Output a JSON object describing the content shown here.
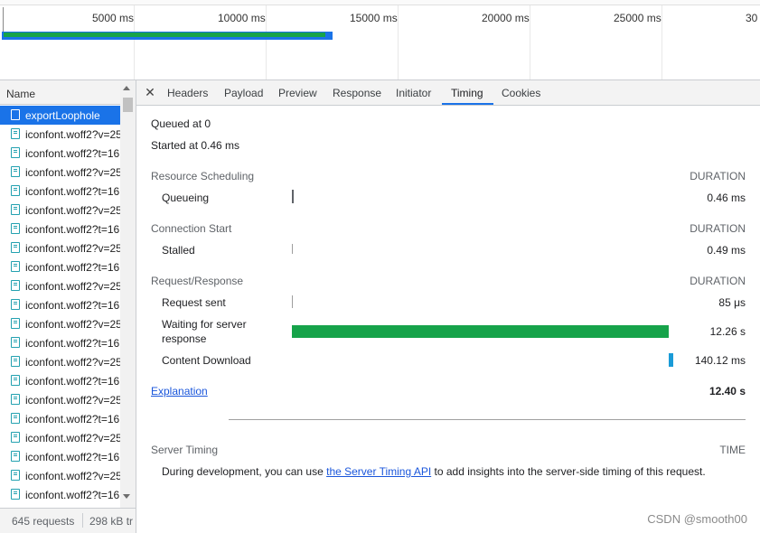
{
  "overview": {
    "ticks": [
      "5000 ms",
      "10000 ms",
      "15000 ms",
      "20000 ms",
      "25000 ms",
      "30"
    ]
  },
  "request_list": {
    "column_header": "Name",
    "rows": [
      "exportLoophole",
      "iconfont.woff2?v=25",
      "iconfont.woff2?t=16",
      "iconfont.woff2?v=25",
      "iconfont.woff2?t=16",
      "iconfont.woff2?v=25",
      "iconfont.woff2?t=16",
      "iconfont.woff2?v=25",
      "iconfont.woff2?t=16",
      "iconfont.woff2?v=25",
      "iconfont.woff2?t=16",
      "iconfont.woff2?v=25",
      "iconfont.woff2?t=16",
      "iconfont.woff2?v=25",
      "iconfont.woff2?t=16",
      "iconfont.woff2?v=25",
      "iconfont.woff2?t=16",
      "iconfont.woff2?v=25",
      "iconfont.woff2?t=16",
      "iconfont.woff2?v=25",
      "iconfont.woff2?t=16"
    ],
    "footer": {
      "requests": "645 requests",
      "transferred": "298 kB tr"
    }
  },
  "tabs": [
    "Headers",
    "Payload",
    "Preview",
    "Response",
    "Initiator",
    "Timing",
    "Cookies"
  ],
  "timing": {
    "queued_at": "Queued at 0",
    "started_at": "Started at 0.46 ms",
    "duration_label": "DURATION",
    "resource_scheduling": {
      "title": "Resource Scheduling",
      "queueing_label": "Queueing",
      "queueing_value": "0.46 ms"
    },
    "connection_start": {
      "title": "Connection Start",
      "stalled_label": "Stalled",
      "stalled_value": "0.49 ms"
    },
    "request_response": {
      "title": "Request/Response",
      "request_sent_label": "Request sent",
      "request_sent_value": "85 μs",
      "waiting_label_1": "Waiting for server",
      "waiting_label_2": "response",
      "waiting_value": "12.26 s",
      "download_label": "Content Download",
      "download_value": "140.12 ms"
    },
    "explanation": "Explanation",
    "total": "12.40 s"
  },
  "server_timing": {
    "title": "Server Timing",
    "time_label": "TIME",
    "text_before": "During development, you can use ",
    "link": "the Server Timing API",
    "text_after": " to add insights into the server-side timing of this request."
  },
  "watermark": "CSDN @smooth00",
  "colors": {
    "accent": "#1a73e8",
    "waiting_bar": "#16a34a",
    "download_bar": "#1a9bd7"
  }
}
